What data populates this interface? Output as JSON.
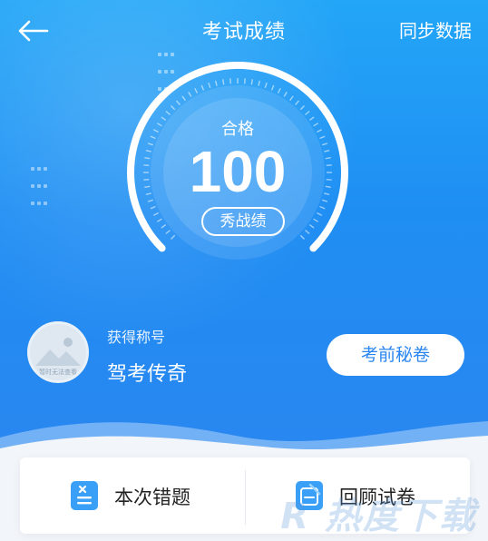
{
  "header": {
    "title": "考试成绩",
    "sync_label": "同步数据"
  },
  "score_panel": {
    "pass_label": "合格",
    "score": "100",
    "show_button": "秀战绩"
  },
  "profile": {
    "avatar_caption": "暂时无法查看",
    "title_label": "获得称号",
    "title_value": "驾考传奇",
    "secret_button": "考前秘卷"
  },
  "actions": [
    {
      "label": "本次错题",
      "icon": "wrong-questions-icon"
    },
    {
      "label": "回顾试卷",
      "icon": "review-paper-icon"
    }
  ],
  "watermark": "R 热度下载",
  "colors": {
    "primary_blue": "#2a86f0",
    "hero_top": "#23a6f7"
  }
}
